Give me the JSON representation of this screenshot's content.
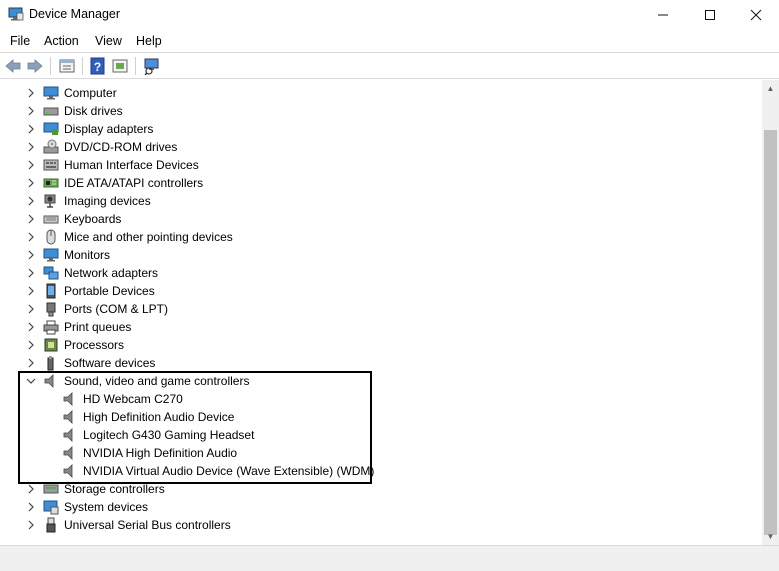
{
  "window": {
    "title": "Device Manager"
  },
  "menu": [
    "File",
    "Action",
    "View",
    "Help"
  ],
  "toolbar": [
    "back-icon",
    "forward-icon",
    "properties-icon",
    "help-icon",
    "update-driver-icon",
    "scan-hardware-icon"
  ],
  "tree": {
    "categories_before": [
      {
        "label": "Computer",
        "icon": "computer-icon"
      },
      {
        "label": "Disk drives",
        "icon": "disk-drive-icon"
      },
      {
        "label": "Display adapters",
        "icon": "display-adapter-icon"
      },
      {
        "label": "DVD/CD-ROM drives",
        "icon": "dvd-drive-icon"
      },
      {
        "label": "Human Interface Devices",
        "icon": "hid-icon"
      },
      {
        "label": "IDE ATA/ATAPI controllers",
        "icon": "ide-controller-icon"
      },
      {
        "label": "Imaging devices",
        "icon": "camera-icon"
      },
      {
        "label": "Keyboards",
        "icon": "keyboard-icon"
      },
      {
        "label": "Mice and other pointing devices",
        "icon": "mouse-icon"
      },
      {
        "label": "Monitors",
        "icon": "monitor-icon"
      },
      {
        "label": "Network adapters",
        "icon": "network-adapter-icon"
      },
      {
        "label": "Portable Devices",
        "icon": "portable-device-icon"
      },
      {
        "label": "Ports (COM & LPT)",
        "icon": "port-icon"
      },
      {
        "label": "Print queues",
        "icon": "printer-icon"
      },
      {
        "label": "Processors",
        "icon": "processor-icon"
      },
      {
        "label": "Software devices",
        "icon": "software-device-icon"
      }
    ],
    "expanded": {
      "label": "Sound, video and game controllers",
      "icon": "speaker-icon",
      "children": [
        "HD Webcam C270",
        "High Definition Audio Device",
        "Logitech G430 Gaming Headset",
        "NVIDIA High Definition Audio",
        "NVIDIA Virtual Audio Device (Wave Extensible) (WDM)"
      ]
    },
    "categories_after": [
      {
        "label": "Storage controllers",
        "icon": "storage-controller-icon"
      },
      {
        "label": "System devices",
        "icon": "system-device-icon"
      },
      {
        "label": "Universal Serial Bus controllers",
        "icon": "usb-icon"
      }
    ]
  },
  "colors": {
    "accent": "#1e7ad8",
    "highlight_border": "#000000"
  }
}
